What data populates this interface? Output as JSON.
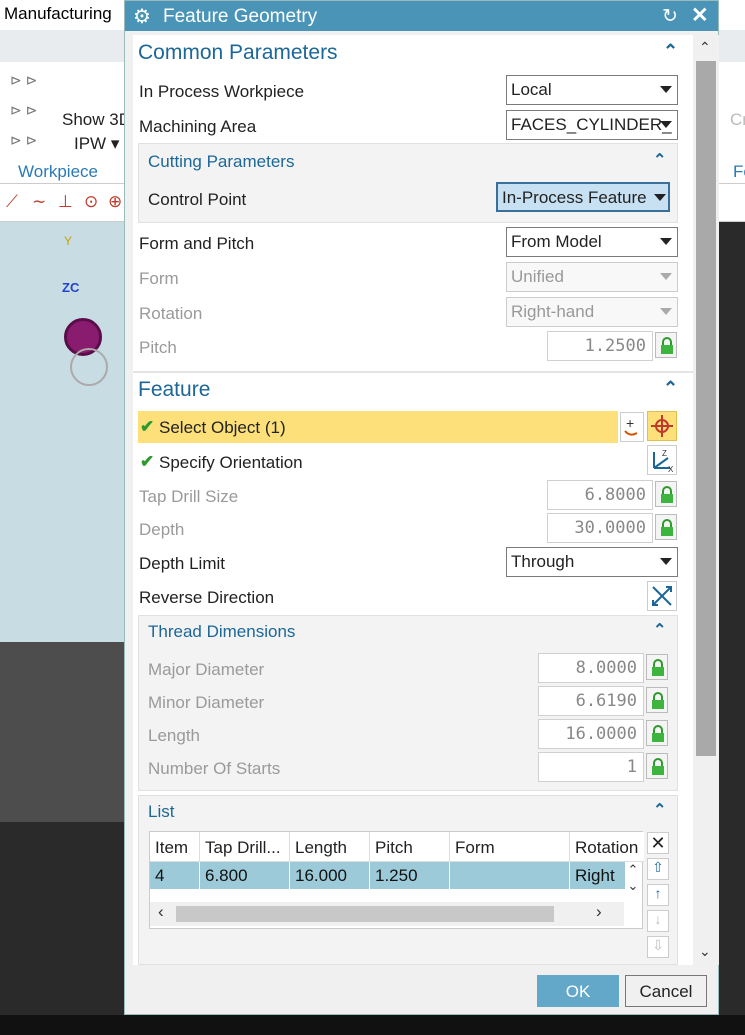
{
  "background": {
    "app_title": "Manufacturing",
    "show3d_label": "Show 3D",
    "ipw_label": "IPW",
    "workpiece_tab": "Workpiece",
    "right_fragment_top": "Cr",
    "right_fragment_tab": "Fe",
    "axis_y": "Y",
    "axis_zc": "ZC"
  },
  "dialog": {
    "title": "Feature Geometry",
    "common": {
      "title": "Common Parameters",
      "in_process_workpiece_label": "In Process Workpiece",
      "in_process_workpiece_value": "Local",
      "machining_area_label": "Machining Area",
      "machining_area_value": "FACES_CYLINDER_",
      "cutting_params_title": "Cutting Parameters",
      "control_point_label": "Control Point",
      "control_point_value": "In-Process Feature",
      "form_and_pitch_label": "Form and Pitch",
      "form_and_pitch_value": "From Model",
      "form_label": "Form",
      "form_value": "Unified",
      "rotation_label": "Rotation",
      "rotation_value": "Right-hand",
      "pitch_label": "Pitch",
      "pitch_value": "1.2500"
    },
    "feature": {
      "title": "Feature",
      "select_object_label": "Select Object (1)",
      "specify_orientation_label": "Specify Orientation",
      "tap_drill_size_label": "Tap Drill Size",
      "tap_drill_size_value": "6.8000",
      "depth_label": "Depth",
      "depth_value": "30.0000",
      "depth_limit_label": "Depth Limit",
      "depth_limit_value": "Through",
      "reverse_direction_label": "Reverse Direction",
      "thread_dims_title": "Thread Dimensions",
      "major_diameter_label": "Major Diameter",
      "major_diameter_value": "8.0000",
      "minor_diameter_label": "Minor Diameter",
      "minor_diameter_value": "6.6190",
      "length_label": "Length",
      "length_value": "16.0000",
      "num_starts_label": "Number Of Starts",
      "num_starts_value": "1"
    },
    "list": {
      "title": "List",
      "columns": [
        "Item",
        "Tap Drill...",
        "Length",
        "Pitch",
        "Form",
        "Rotation"
      ],
      "rows": [
        [
          "4",
          "6.800",
          "16.000",
          "1.250",
          "",
          "Right"
        ]
      ]
    },
    "ok_label": "OK",
    "cancel_label": "Cancel"
  },
  "colors": {
    "title_bar": "#4a95b7",
    "section_title": "#1c6797",
    "highlight_row": "#fde07a",
    "selected_table_row": "#9ccad9",
    "ok_button": "#63a8c8"
  }
}
